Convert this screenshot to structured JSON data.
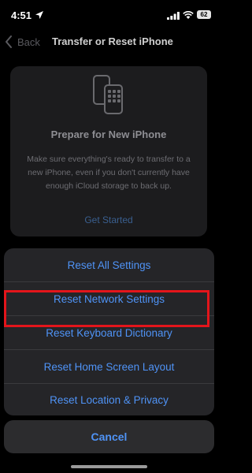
{
  "status_bar": {
    "time": "4:51",
    "battery_level": "62",
    "icons": [
      "location-arrow-icon",
      "signal-icon",
      "wifi-icon",
      "battery-icon"
    ]
  },
  "nav": {
    "back_label": "Back",
    "title": "Transfer or Reset iPhone"
  },
  "prepare_card": {
    "icon": "phones-icon",
    "title": "Prepare for New iPhone",
    "description": "Make sure everything's ready to transfer to a new iPhone, even if you don't currently have enough iCloud storage to back up.",
    "action_label": "Get Started"
  },
  "action_sheet": {
    "options": [
      {
        "label": "Reset All Settings"
      },
      {
        "label": "Reset Network Settings"
      },
      {
        "label": "Reset Keyboard Dictionary",
        "highlighted": true
      },
      {
        "label": "Reset Home Screen Layout"
      },
      {
        "label": "Reset Location & Privacy"
      }
    ],
    "cancel_label": "Cancel"
  },
  "colors": {
    "accent": "#4f93f6",
    "highlight_border": "#e3151b",
    "sheet_background": "#252528",
    "card_background": "#1c1c1e"
  }
}
